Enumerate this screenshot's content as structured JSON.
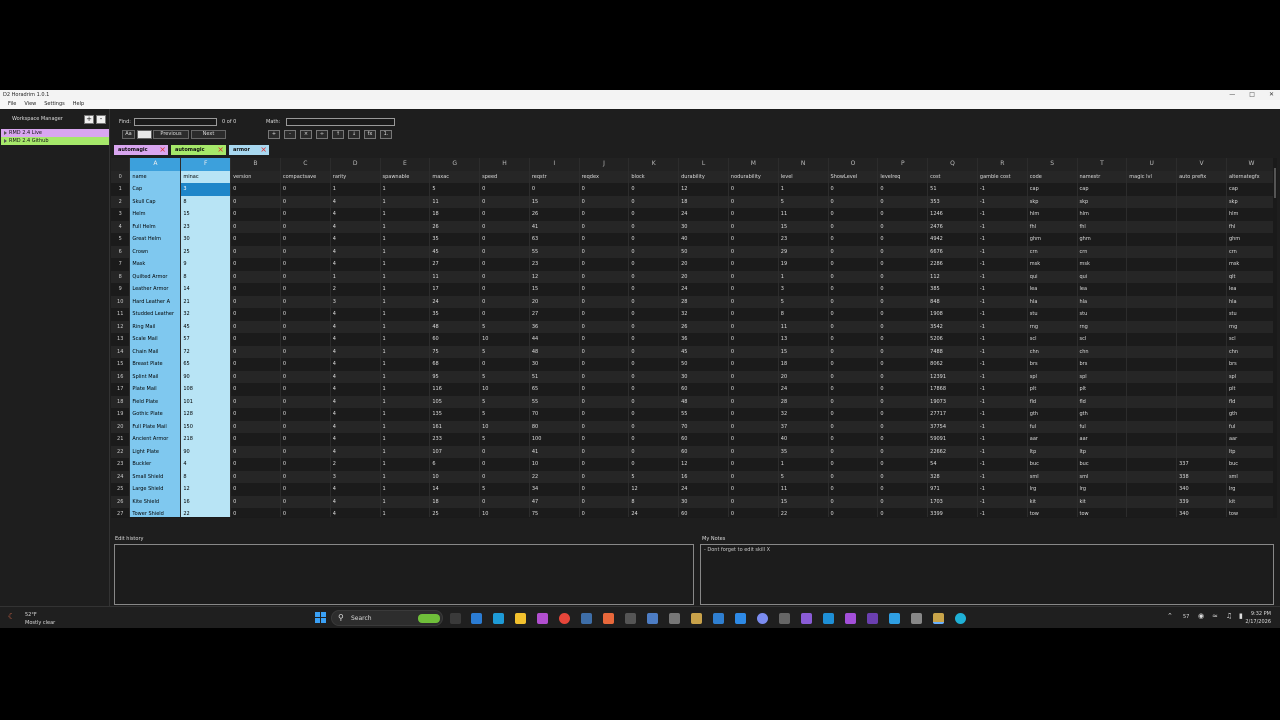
{
  "window": {
    "title": "D2 Horadrim 1.0.1"
  },
  "menu": [
    "File",
    "View",
    "Settings",
    "Help"
  ],
  "workspace": {
    "label": "Workspace Manager",
    "add": "+",
    "remove": "-",
    "items": [
      "RMD 2.4 Live",
      "RMD 2.4 Github"
    ]
  },
  "find": {
    "label": "Find:",
    "value": "",
    "count": "0 of 0",
    "case_label": "Aa",
    "prev_label": "Previous",
    "next_label": "Next"
  },
  "math": {
    "label": "Math:",
    "value": "",
    "ops": [
      "+",
      "-",
      "×",
      "÷",
      "↑",
      "↓",
      "fx",
      "1."
    ]
  },
  "tabs": [
    {
      "label": "automagic",
      "color": "#d9a6f0"
    },
    {
      "label": "automagic",
      "color": "#a6e86a"
    },
    {
      "label": "armor",
      "color": "#a8d8f0"
    }
  ],
  "grid": {
    "letters": [
      "",
      "A",
      "F",
      "B",
      "C",
      "D",
      "E",
      "G",
      "H",
      "I",
      "J",
      "K",
      "L",
      "M",
      "N",
      "O",
      "P",
      "Q",
      "R",
      "S",
      "T",
      "U",
      "V",
      "W"
    ],
    "headers": [
      "0",
      "name",
      "minac",
      "version",
      "compactsave",
      "rarity",
      "spawnable",
      "maxac",
      "speed",
      "reqstr",
      "reqdex",
      "block",
      "durability",
      "nodurability",
      "level",
      "ShowLevel",
      "levelreq",
      "cost",
      "gamble cost",
      "code",
      "namestr",
      "magic lvl",
      "auto prefix",
      "alternategfx"
    ],
    "rows": [
      [
        "1",
        "Cap",
        "3",
        "0",
        "0",
        "1",
        "1",
        "5",
        "0",
        "0",
        "0",
        "0",
        "12",
        "0",
        "1",
        "0",
        "0",
        "51",
        "-1",
        "cap",
        "cap",
        "",
        "",
        "cap"
      ],
      [
        "2",
        "Skull Cap",
        "8",
        "0",
        "0",
        "4",
        "1",
        "11",
        "0",
        "15",
        "0",
        "0",
        "18",
        "0",
        "5",
        "0",
        "0",
        "353",
        "-1",
        "skp",
        "skp",
        "",
        "",
        "skp"
      ],
      [
        "3",
        "Helm",
        "15",
        "0",
        "0",
        "4",
        "1",
        "18",
        "0",
        "26",
        "0",
        "0",
        "24",
        "0",
        "11",
        "0",
        "0",
        "1246",
        "-1",
        "hlm",
        "hlm",
        "",
        "",
        "hlm"
      ],
      [
        "4",
        "Full Helm",
        "23",
        "0",
        "0",
        "4",
        "1",
        "26",
        "0",
        "41",
        "0",
        "0",
        "30",
        "0",
        "15",
        "0",
        "0",
        "2476",
        "-1",
        "fhl",
        "fhl",
        "",
        "",
        "fhl"
      ],
      [
        "5",
        "Great Helm",
        "30",
        "0",
        "0",
        "4",
        "1",
        "35",
        "0",
        "63",
        "0",
        "0",
        "40",
        "0",
        "23",
        "0",
        "0",
        "4942",
        "-1",
        "ghm",
        "ghm",
        "",
        "",
        "ghm"
      ],
      [
        "6",
        "Crown",
        "25",
        "0",
        "0",
        "4",
        "1",
        "45",
        "0",
        "55",
        "0",
        "0",
        "50",
        "0",
        "29",
        "0",
        "0",
        "6676",
        "-1",
        "crn",
        "crn",
        "",
        "",
        "crn"
      ],
      [
        "7",
        "Mask",
        "9",
        "0",
        "0",
        "4",
        "1",
        "27",
        "0",
        "23",
        "0",
        "0",
        "20",
        "0",
        "19",
        "0",
        "0",
        "2286",
        "-1",
        "msk",
        "msk",
        "",
        "",
        "msk"
      ],
      [
        "8",
        "Quilted Armor",
        "8",
        "0",
        "0",
        "1",
        "1",
        "11",
        "0",
        "12",
        "0",
        "0",
        "20",
        "0",
        "1",
        "0",
        "0",
        "112",
        "-1",
        "qui",
        "qui",
        "",
        "",
        "qlt"
      ],
      [
        "9",
        "Leather Armor",
        "14",
        "0",
        "0",
        "2",
        "1",
        "17",
        "0",
        "15",
        "0",
        "0",
        "24",
        "0",
        "3",
        "0",
        "0",
        "385",
        "-1",
        "lea",
        "lea",
        "",
        "",
        "lea"
      ],
      [
        "10",
        "Hard Leather A",
        "21",
        "0",
        "0",
        "3",
        "1",
        "24",
        "0",
        "20",
        "0",
        "0",
        "28",
        "0",
        "5",
        "0",
        "0",
        "848",
        "-1",
        "hla",
        "hla",
        "",
        "",
        "hla"
      ],
      [
        "11",
        "Studded Leather",
        "32",
        "0",
        "0",
        "4",
        "1",
        "35",
        "0",
        "27",
        "0",
        "0",
        "32",
        "0",
        "8",
        "0",
        "0",
        "1908",
        "-1",
        "stu",
        "stu",
        "",
        "",
        "stu"
      ],
      [
        "12",
        "Ring Mail",
        "45",
        "0",
        "0",
        "4",
        "1",
        "48",
        "5",
        "36",
        "0",
        "0",
        "26",
        "0",
        "11",
        "0",
        "0",
        "3542",
        "-1",
        "rng",
        "rng",
        "",
        "",
        "rng"
      ],
      [
        "13",
        "Scale Mail",
        "57",
        "0",
        "0",
        "4",
        "1",
        "60",
        "10",
        "44",
        "0",
        "0",
        "36",
        "0",
        "13",
        "0",
        "0",
        "5206",
        "-1",
        "scl",
        "scl",
        "",
        "",
        "scl"
      ],
      [
        "14",
        "Chain Mail",
        "72",
        "0",
        "0",
        "4",
        "1",
        "75",
        "5",
        "48",
        "0",
        "0",
        "45",
        "0",
        "15",
        "0",
        "0",
        "7488",
        "-1",
        "chn",
        "chn",
        "",
        "",
        "chn"
      ],
      [
        "15",
        "Breast Plate",
        "65",
        "0",
        "0",
        "4",
        "1",
        "68",
        "0",
        "30",
        "0",
        "0",
        "50",
        "0",
        "18",
        "0",
        "0",
        "8062",
        "-1",
        "brs",
        "brs",
        "",
        "",
        "brs"
      ],
      [
        "16",
        "Splint Mail",
        "90",
        "0",
        "0",
        "4",
        "1",
        "95",
        "5",
        "51",
        "0",
        "0",
        "30",
        "0",
        "20",
        "0",
        "0",
        "12391",
        "-1",
        "spl",
        "spl",
        "",
        "",
        "spl"
      ],
      [
        "17",
        "Plate Mail",
        "108",
        "0",
        "0",
        "4",
        "1",
        "116",
        "10",
        "65",
        "0",
        "0",
        "60",
        "0",
        "24",
        "0",
        "0",
        "17868",
        "-1",
        "plt",
        "plt",
        "",
        "",
        "plt"
      ],
      [
        "18",
        "Field Plate",
        "101",
        "0",
        "0",
        "4",
        "1",
        "105",
        "5",
        "55",
        "0",
        "0",
        "48",
        "0",
        "28",
        "0",
        "0",
        "19073",
        "-1",
        "fld",
        "fld",
        "",
        "",
        "fld"
      ],
      [
        "19",
        "Gothic Plate",
        "128",
        "0",
        "0",
        "4",
        "1",
        "135",
        "5",
        "70",
        "0",
        "0",
        "55",
        "0",
        "32",
        "0",
        "0",
        "27717",
        "-1",
        "gth",
        "gth",
        "",
        "",
        "gth"
      ],
      [
        "20",
        "Full Plate Mail",
        "150",
        "0",
        "0",
        "4",
        "1",
        "161",
        "10",
        "80",
        "0",
        "0",
        "70",
        "0",
        "37",
        "0",
        "0",
        "37754",
        "-1",
        "ful",
        "ful",
        "",
        "",
        "ful"
      ],
      [
        "21",
        "Ancient Armor",
        "218",
        "0",
        "0",
        "4",
        "1",
        "233",
        "5",
        "100",
        "0",
        "0",
        "60",
        "0",
        "40",
        "0",
        "0",
        "59091",
        "-1",
        "aar",
        "aar",
        "",
        "",
        "aar"
      ],
      [
        "22",
        "Light Plate",
        "90",
        "0",
        "0",
        "4",
        "1",
        "107",
        "0",
        "41",
        "0",
        "0",
        "60",
        "0",
        "35",
        "0",
        "0",
        "22662",
        "-1",
        "ltp",
        "ltp",
        "",
        "",
        "ltp"
      ],
      [
        "23",
        "Buckler",
        "4",
        "0",
        "0",
        "2",
        "1",
        "6",
        "0",
        "10",
        "0",
        "0",
        "12",
        "0",
        "1",
        "0",
        "0",
        "54",
        "-1",
        "buc",
        "buc",
        "",
        "337",
        "buc"
      ],
      [
        "24",
        "Small Shield",
        "8",
        "0",
        "0",
        "3",
        "1",
        "10",
        "0",
        "22",
        "0",
        "5",
        "16",
        "0",
        "5",
        "0",
        "0",
        "328",
        "-1",
        "sml",
        "sml",
        "",
        "338",
        "sml"
      ],
      [
        "25",
        "Large Shield",
        "12",
        "0",
        "0",
        "4",
        "1",
        "14",
        "5",
        "34",
        "0",
        "12",
        "24",
        "0",
        "11",
        "0",
        "0",
        "971",
        "-1",
        "lrg",
        "lrg",
        "",
        "340",
        "lrg"
      ],
      [
        "26",
        "Kite Shield",
        "16",
        "0",
        "0",
        "4",
        "1",
        "18",
        "0",
        "47",
        "0",
        "8",
        "30",
        "0",
        "15",
        "0",
        "0",
        "1703",
        "-1",
        "kit",
        "kit",
        "",
        "339",
        "kit"
      ],
      [
        "27",
        "Tower Shield",
        "22",
        "0",
        "0",
        "4",
        "1",
        "25",
        "10",
        "75",
        "0",
        "24",
        "60",
        "0",
        "22",
        "0",
        "0",
        "3399",
        "-1",
        "tow",
        "tow",
        "",
        "340",
        "tow"
      ]
    ]
  },
  "edit_history": {
    "title": "Edit history",
    "content": ""
  },
  "notes": {
    "title": "My Notes",
    "content": "- Dont forget to edit skill X"
  },
  "taskbar": {
    "weather_temp": "52°F",
    "weather_desc": "Mostly clear",
    "search_label": "Search",
    "time": "9:32 PM",
    "date": "2/17/2026",
    "tray_num": "57"
  }
}
